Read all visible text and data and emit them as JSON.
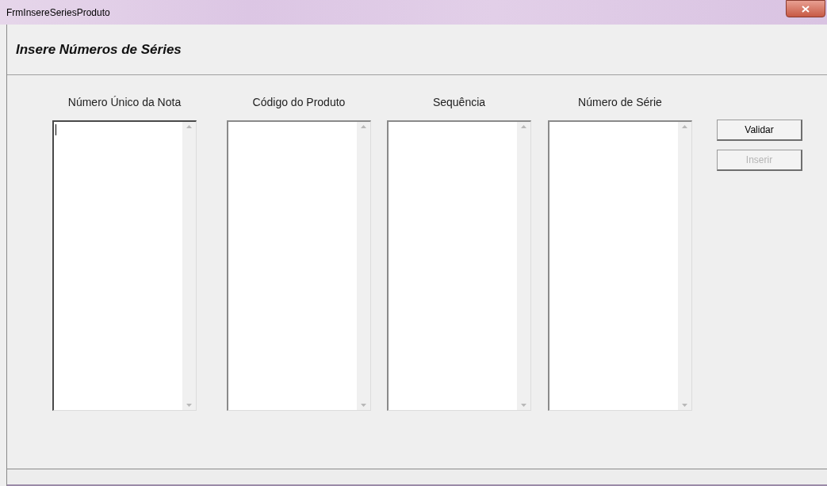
{
  "window": {
    "title": "FrmInsereSeriesProduto"
  },
  "heading": "Insere Números de Séries",
  "columns": [
    {
      "label": "Número Único da Nota",
      "focused": true
    },
    {
      "label": "Código do Produto",
      "focused": false
    },
    {
      "label": "Sequência",
      "focused": false
    },
    {
      "label": "Número de Série",
      "focused": false
    }
  ],
  "buttons": [
    {
      "label": "Validar",
      "disabled": false
    },
    {
      "label": "Inserir",
      "disabled": true
    }
  ]
}
